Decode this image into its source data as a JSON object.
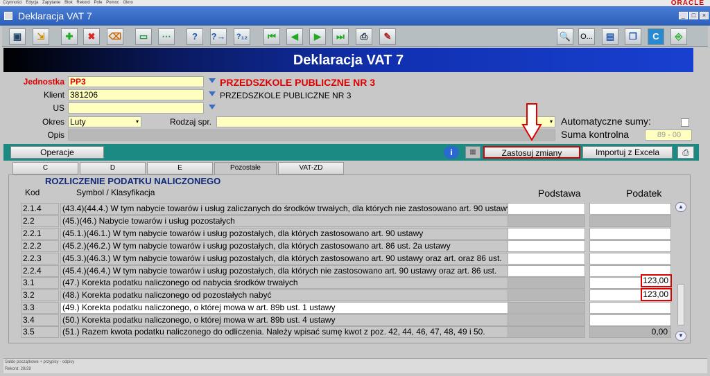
{
  "menubar": {
    "items": [
      "Czynności",
      "Edycja",
      "Zapytanie",
      "Blok",
      "Rekord",
      "Pole",
      "Pomoc",
      "Okno"
    ],
    "brand": "ORACLE"
  },
  "window": {
    "title": "Deklaracja VAT 7"
  },
  "toolbar": {
    "buttons": [
      "save-icon",
      "exit-icon",
      "insert-record-icon",
      "delete-record-icon",
      "clear-record-icon",
      "execute-query-icon",
      "cancel-query-icon",
      "help-query-icon",
      "next-help-icon",
      "count-query-icon",
      "first-record-icon",
      "previous-record-icon",
      "next-record-icon",
      "last-record-icon",
      "print-icon",
      "edit-icon",
      "preview-icon",
      "o-label",
      "save-file-icon",
      "windows-icon",
      "calc-icon",
      "exit-door-icon"
    ],
    "o_label": "O..."
  },
  "banner": {
    "title": "Deklaracja VAT 7"
  },
  "form": {
    "jednostka_label": "Jednostka",
    "jednostka_value": "PP3",
    "jednostka_name": "PRZEDSZKOLE PUBLICZNE NR 3",
    "klient_label": "Klient",
    "klient_value": "381206",
    "klient_name": "PRZEDSZKOLE PUBLICZNE NR 3",
    "us_label": "US",
    "us_value": "",
    "okres_label": "Okres",
    "okres_value": "Luty",
    "rodzaj_label": "Rodzaj spr.",
    "rodzaj_value": "",
    "opis_label": "Opis",
    "opis_value": "",
    "auto_label": "Automatyczne sumy:",
    "suma_label": "Suma kontrolna",
    "suma_value": "89 - 00"
  },
  "actions": {
    "operacje": "Operacje",
    "zastosuj": "Zastosuj zmiany",
    "importuj": "Importuj z Excela"
  },
  "tabs": [
    "C",
    "D",
    "E",
    "Pozostałe",
    "VAT-ZD"
  ],
  "section": {
    "title": "ROZLICZENIE PODATKU NALICZONEGO",
    "col_kod": "Kod",
    "col_symbol": "Symbol / Klasyfikacja",
    "col_podstawa": "Podstawa",
    "col_podatek": "Podatek"
  },
  "rows": [
    {
      "kod": "2.1.4",
      "desc": "(43.4)(44.4.) W tym nabycie towarów i usług zaliczanych do środków trwałych, dla których nie zastosowano art. 90 ustawy",
      "podatek": ""
    },
    {
      "kod": "2.2",
      "desc": "(45.)(46.) Nabycie towarów i usług pozostałych",
      "podatek": ""
    },
    {
      "kod": "2.2.1",
      "desc": "(45.1.)(46.1.) W tym nabycie towarów i usług pozostałych, dla których zastosowano art. 90 ustawy",
      "podatek": ""
    },
    {
      "kod": "2.2.2",
      "desc": "(45.2.)(46.2.) W tym nabycie towarów i usług pozostałych, dla których zastosowano art. 86 ust. 2a ustawy",
      "podatek": ""
    },
    {
      "kod": "2.2.3",
      "desc": "(45.3.)(46.3.) W tym nabycie towarów i usług pozostałych, dla których zastosowano art. 90 ustawy oraz art. oraz 86 ust.",
      "podatek": ""
    },
    {
      "kod": "2.2.4",
      "desc": "(45.4.)(46.4.) W tym nabycie towarów i usług pozostałych, dla których nie zastosowano art. 90 ustawy oraz art. 86 ust.",
      "podatek": ""
    },
    {
      "kod": "3.1",
      "desc": "(47.) Korekta podatku naliczonego od nabycia środków trwałych",
      "podatek": "123,00"
    },
    {
      "kod": "3.2",
      "desc": "(48.) Korekta podatku naliczonego od pozostałych nabyć",
      "podatek": "123,00"
    },
    {
      "kod": "3.3",
      "desc": "(49.) Korekta podatku naliczonego, o której mowa w art. 89b ust. 1 ustawy",
      "podatek": ""
    },
    {
      "kod": "3.4",
      "desc": "(50.) Korekta podatku naliczonego, o której mowa w art. 89b ust. 4 ustawy",
      "podatek": ""
    },
    {
      "kod": "3.5",
      "desc": "(51.) Razem kwota podatku naliczonego do odliczenia. Należy wpisać sumę kwot z poz. 42, 44, 46, 47, 48, 49 i 50.",
      "podatek": "0,00"
    }
  ],
  "status": {
    "line1": "Saldo początkowe + przypisy - odpisy",
    "line2": "Rekord: 28/28"
  }
}
